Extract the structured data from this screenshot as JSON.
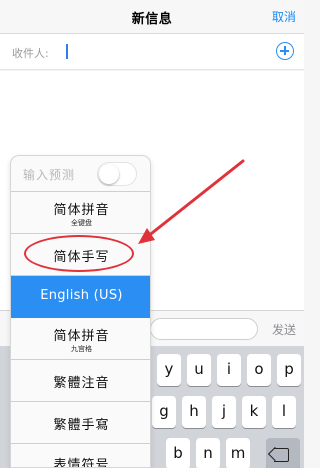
{
  "navbar": {
    "title": "新信息",
    "cancel_label": "取消"
  },
  "recipient": {
    "label": "收件人:"
  },
  "compose": {
    "send_label": "发送"
  },
  "input_menu": {
    "predictive_label": "输入预测",
    "predictive_enabled": false,
    "items": [
      {
        "label": "简体拼音",
        "sublabel": "全键盘"
      },
      {
        "label": "简体手写"
      },
      {
        "label": "English (US)",
        "selected": true
      },
      {
        "label": "简体拼音",
        "sublabel": "九宫格"
      },
      {
        "label": "繁體注音"
      },
      {
        "label": "繁體手寫"
      },
      {
        "label": "表情符号"
      }
    ]
  },
  "keyboard": {
    "row1_keys": [
      "y",
      "u",
      "i",
      "o",
      "p"
    ],
    "row2_keys": [
      "g",
      "h",
      "j",
      "k",
      "l"
    ],
    "row3_keys": [
      "b",
      "n",
      "m"
    ]
  },
  "colors": {
    "accent": "#2b8ef2",
    "annotation": "#e0323a"
  }
}
